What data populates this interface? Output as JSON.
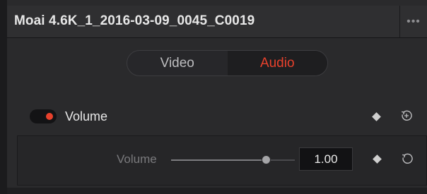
{
  "header": {
    "clip_name": "Moai 4.6K_1_2016-03-09_0045_C0019",
    "more_label": "•••"
  },
  "tabs": [
    {
      "label": "Video",
      "active": false
    },
    {
      "label": "Audio",
      "active": true
    }
  ],
  "volume_section": {
    "label": "Volume",
    "enabled": true,
    "keyframe_icon": "diamond-icon",
    "reset_icon": "reset-icon"
  },
  "volume_param": {
    "label": "Volume",
    "value": "1.00",
    "slider_position": 0.77,
    "keyframe_icon": "diamond-icon",
    "reset_icon": "reset-icon"
  },
  "colors": {
    "accent": "#e8412c",
    "panel_bg": "#2a2a2c",
    "header_bg": "#2f2f31",
    "text": "#e7e7e7"
  }
}
